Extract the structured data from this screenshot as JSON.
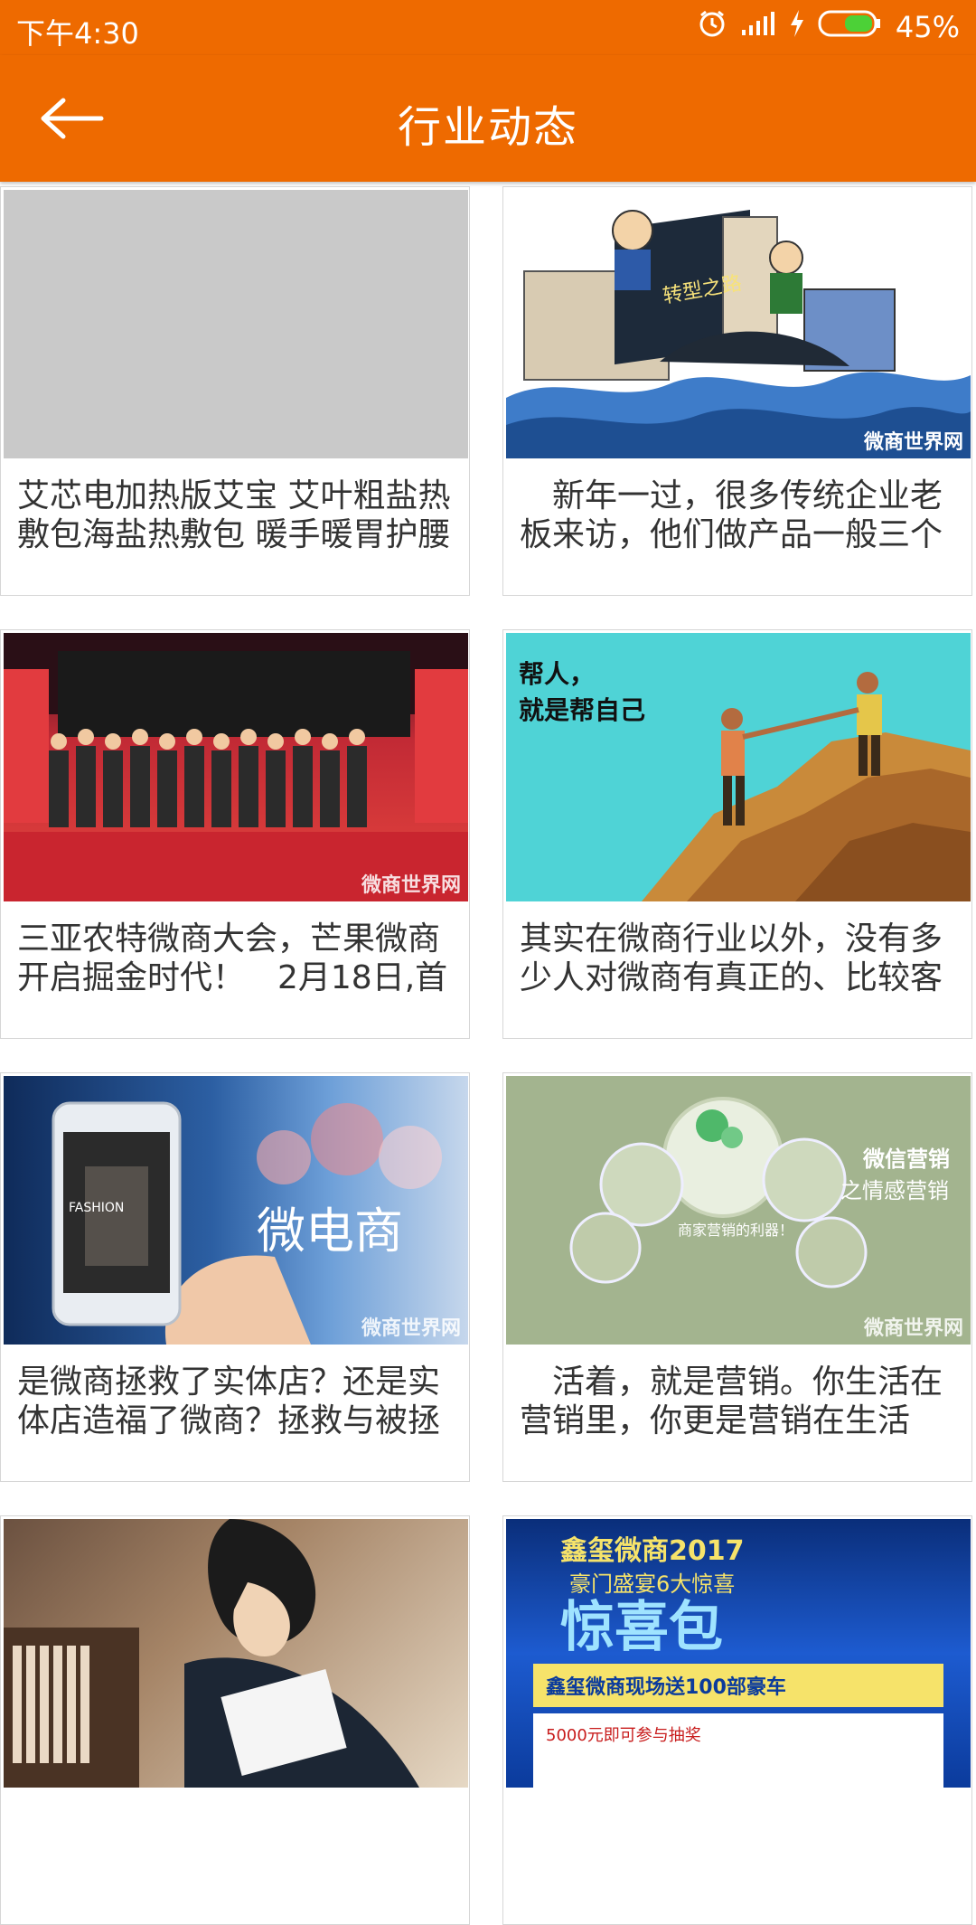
{
  "status_bar": {
    "time": "下午4:30",
    "battery": "45%",
    "icons": [
      "alarm-icon",
      "signal-icon",
      "charging-icon",
      "battery-icon"
    ]
  },
  "app_bar": {
    "title": "行业动态",
    "back_icon": "back-arrow-icon"
  },
  "colors": {
    "primary": "#EE6A00",
    "card_border": "#d6d6d6",
    "text": "#333333"
  },
  "articles": [
    {
      "title": "艾芯电加热版艾宝 艾叶粗盐热敷包海盐热敷包 暖手暖胃护腰",
      "image": "placeholder"
    },
    {
      "title": "　新年一过，很多传统企业老板来访，他们做产品一般三个",
      "image": "cartoon-transformation",
      "watermark": "微商世界网",
      "caption": "转型之路"
    },
    {
      "title": "三亚农特微商大会，芒果微商开启掘金时代！　2月18日,首",
      "image": "conference-stage",
      "watermark": "微商世界网"
    },
    {
      "title": "其实在微商行业以外，没有多少人对微商有真正的、比较客",
      "image": "climbers-helping",
      "watermark": "",
      "caption": "帮人，\n就是帮自己"
    },
    {
      "title": "是微商拯救了实体店？还是实体店造福了微商？拯救与被拯",
      "image": "phone-weishang",
      "watermark": "微商世界网",
      "caption": "微电商"
    },
    {
      "title": "　活着，就是营销。你生活在营销里，你更是营销在生活",
      "image": "wechat-marketing",
      "watermark": "微商世界网",
      "caption": "微信营销\n之情感营销"
    },
    {
      "title": "",
      "image": "man-reading"
    },
    {
      "title": "",
      "image": "surprise-poster",
      "caption": "惊喜包"
    }
  ]
}
